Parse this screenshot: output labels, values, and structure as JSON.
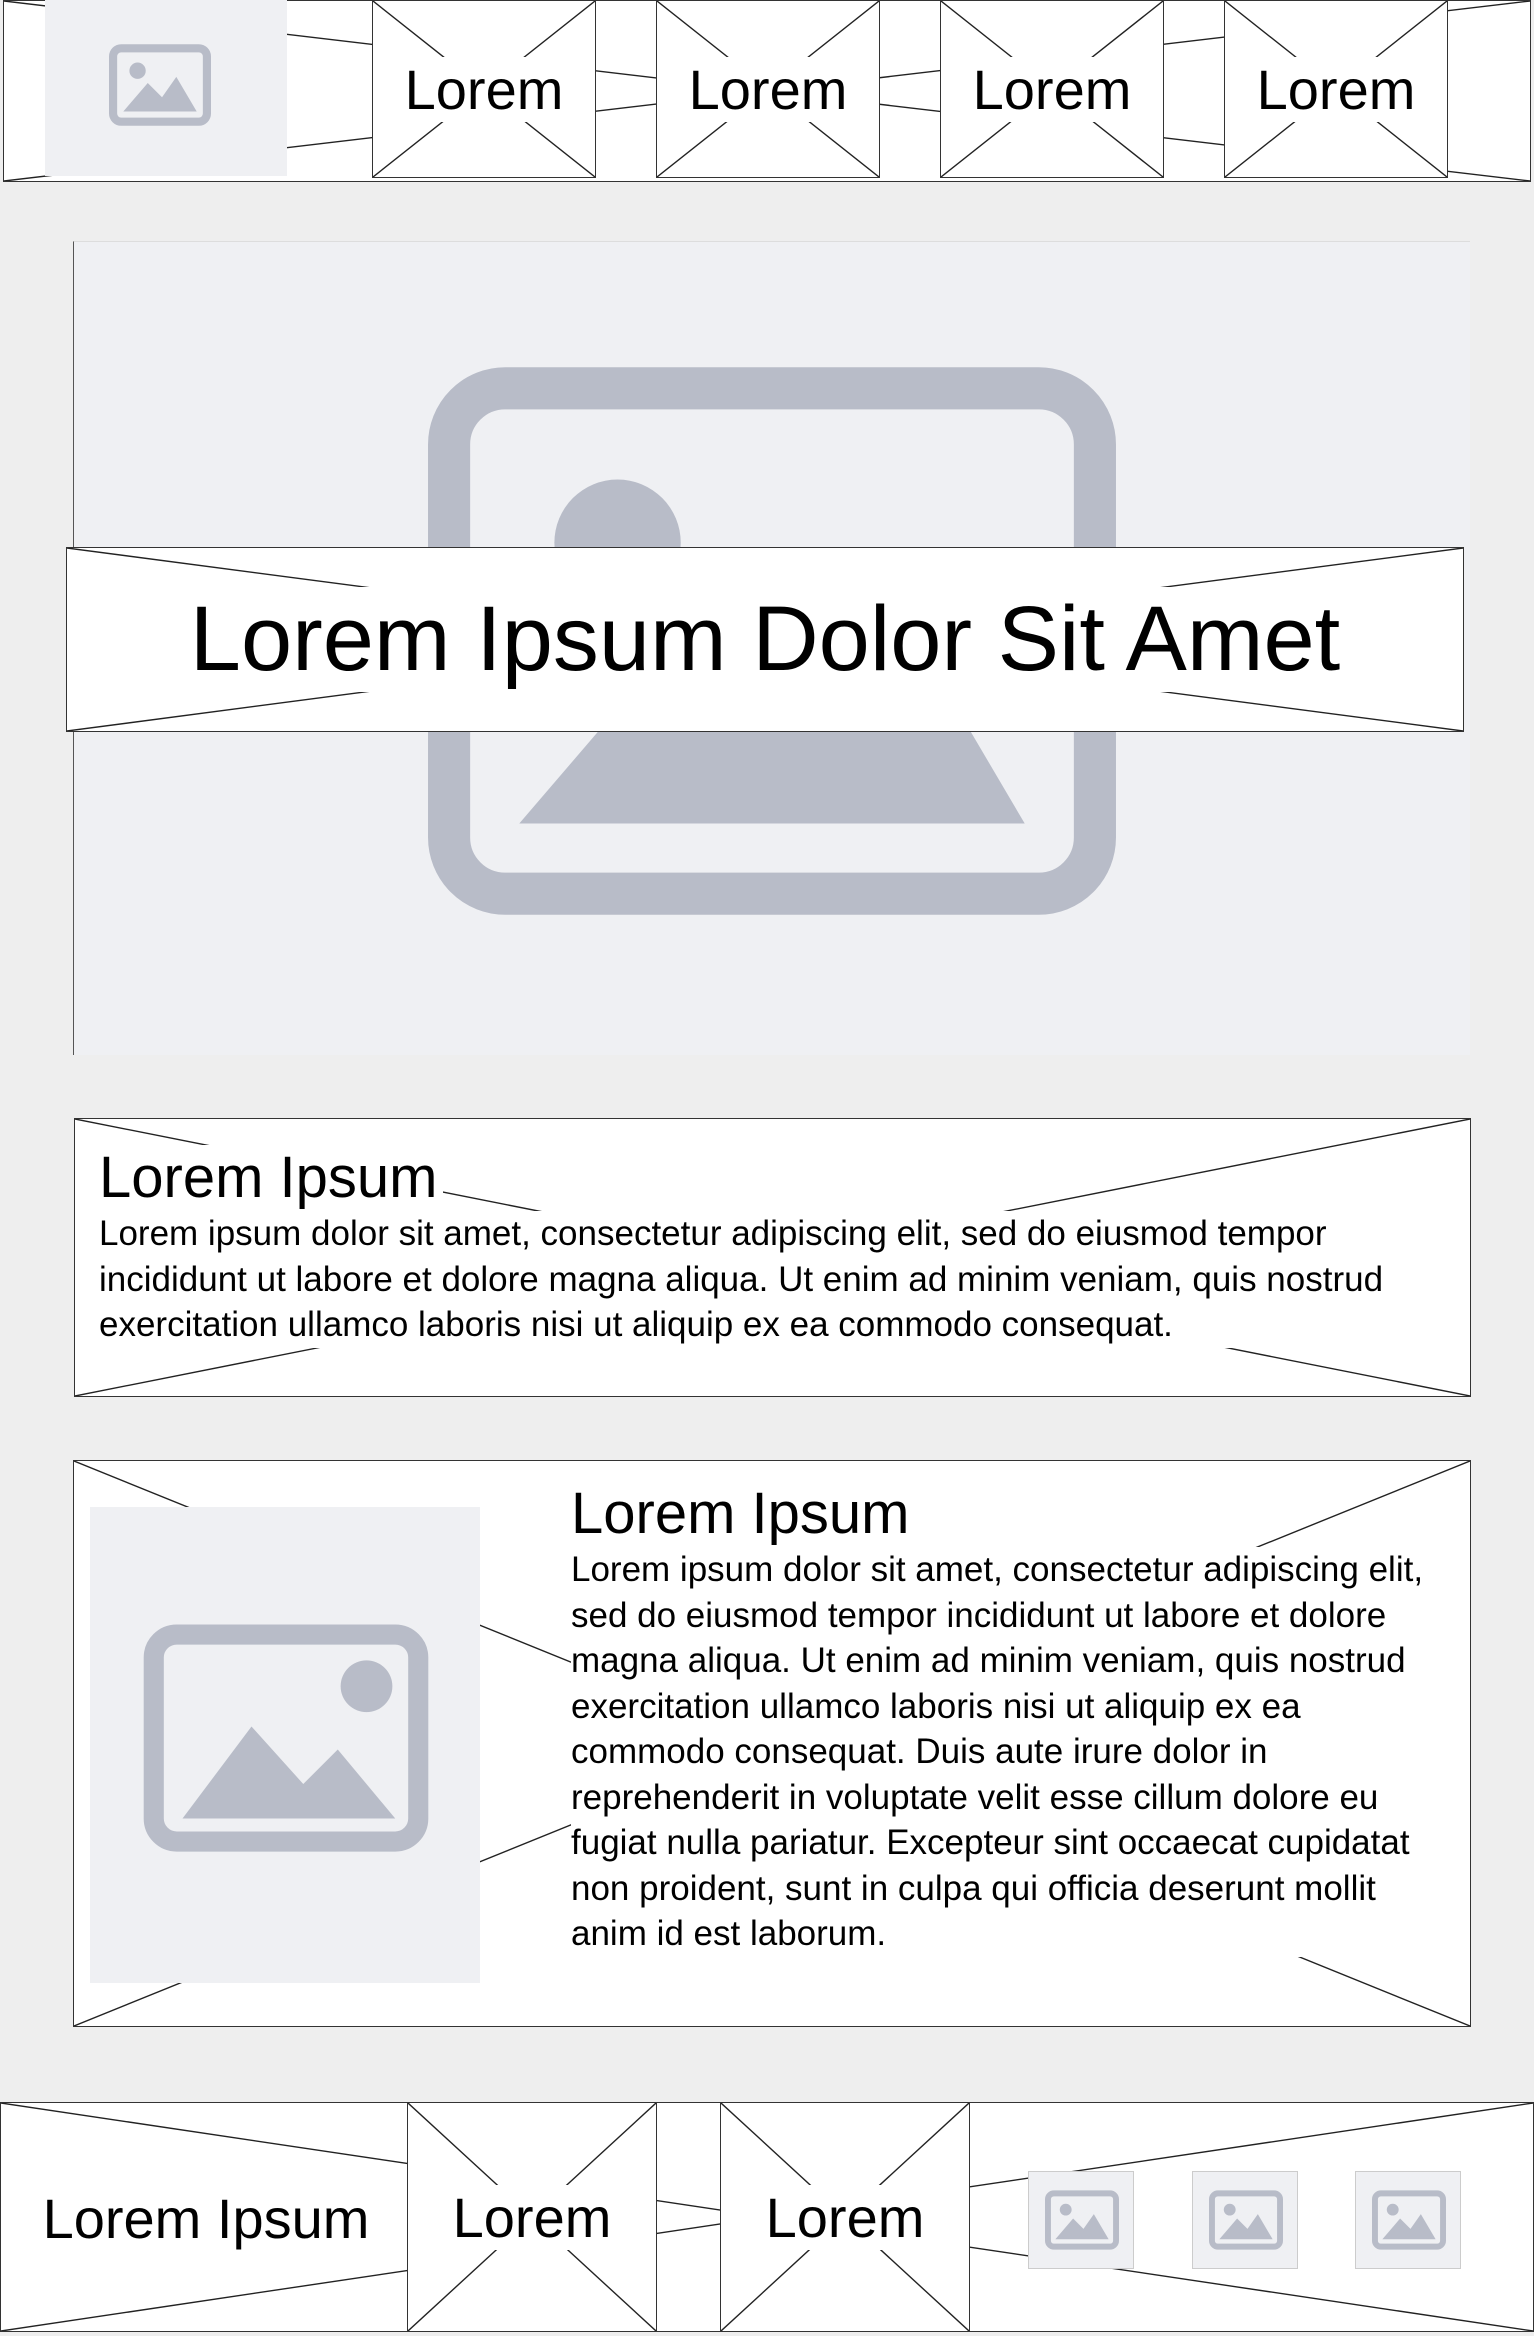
{
  "header": {
    "logo_icon": "image-placeholder-icon",
    "nav_items": [
      {
        "label": "Lorem"
      },
      {
        "label": "Lorem"
      },
      {
        "label": "Lorem"
      },
      {
        "label": "Lorem"
      }
    ]
  },
  "hero": {
    "image_icon": "image-placeholder-icon",
    "title": "Lorem Ipsum Dolor Sit Amet"
  },
  "section1": {
    "heading": "Lorem Ipsum",
    "body": "Lorem ipsum dolor sit amet, consectetur adipiscing elit, sed do eiusmod tempor incididunt ut labore et dolore magna aliqua. Ut enim ad minim veniam, quis nostrud exercitation ullamco laboris nisi ut aliquip ex ea commodo consequat."
  },
  "section2": {
    "image_icon": "image-placeholder-icon",
    "heading": "Lorem Ipsum",
    "body": "Lorem ipsum dolor sit amet, consectetur adipiscing elit, sed do eiusmod tempor incididunt ut labore et dolore magna aliqua. Ut enim ad minim veniam, quis nostrud exercitation ullamco laboris nisi ut aliquip ex ea commodo consequat. Duis aute irure dolor in reprehenderit in voluptate velit esse cillum dolore eu fugiat nulla pariatur. Excepteur sint occaecat cupidatat non proident, sunt in culpa qui officia deserunt mollit anim id est laborum."
  },
  "footer": {
    "brand": "Lorem Ipsum",
    "links": [
      {
        "label": "Lorem"
      },
      {
        "label": "Lorem"
      }
    ],
    "social_icons": [
      "image-placeholder-icon",
      "image-placeholder-icon",
      "image-placeholder-icon"
    ]
  },
  "colors": {
    "page_background": "#eeeeee",
    "placeholder_background": "#eff0f3",
    "placeholder_icon": "#b8bcc8",
    "outline": "#333333"
  }
}
